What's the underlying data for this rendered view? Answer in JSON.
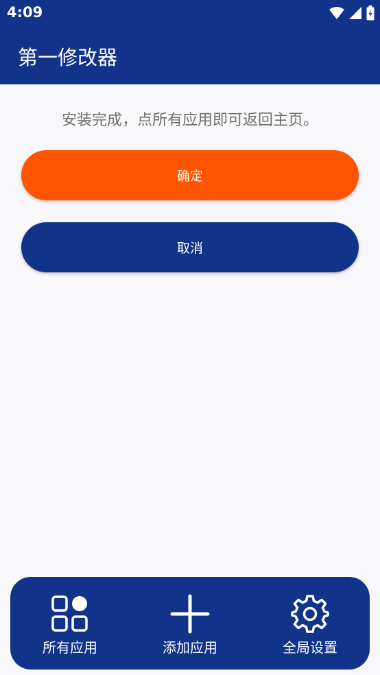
{
  "status_bar": {
    "time": "4:09"
  },
  "app_bar": {
    "title": "第一修改器"
  },
  "main": {
    "message": "安装完成，点所有应用即可返回主页。",
    "confirm_label": "确定",
    "cancel_label": "取消"
  },
  "bottom_nav": {
    "items": [
      {
        "label": "所有应用",
        "icon": "apps-grid-icon"
      },
      {
        "label": "添加应用",
        "icon": "plus-icon"
      },
      {
        "label": "全局设置",
        "icon": "gear-icon"
      }
    ]
  },
  "colors": {
    "primary": "#11338a",
    "accent": "#ff5500",
    "background": "#f8f8fa"
  }
}
